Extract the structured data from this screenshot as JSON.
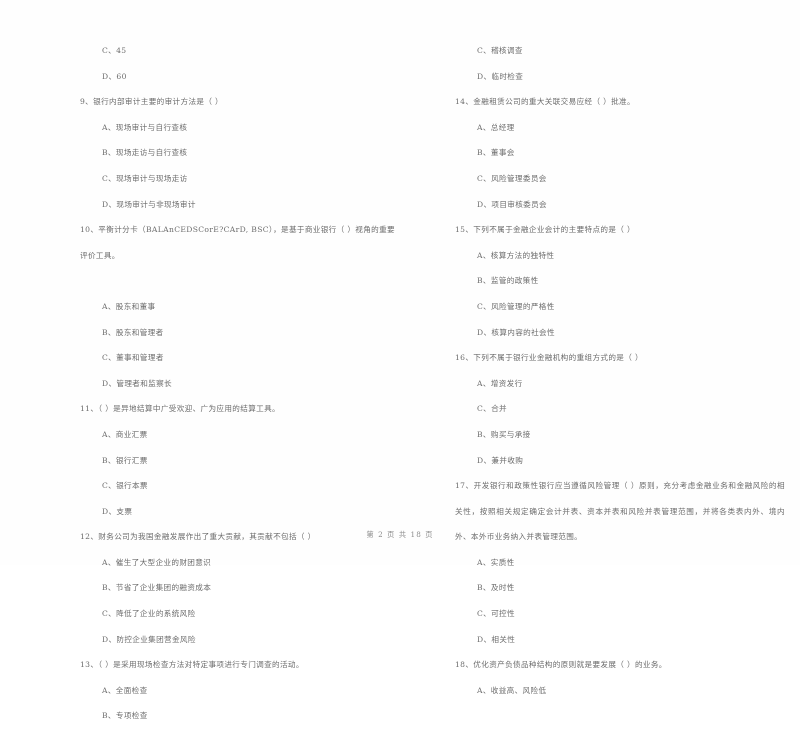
{
  "document": {
    "type": "scanned-exam-paper",
    "language": "zh-CN",
    "footer": "第 2 页 共 18 页"
  },
  "left_column": {
    "items": [
      {
        "kind": "option",
        "text": "C、45"
      },
      {
        "kind": "option",
        "text": "D、60"
      },
      {
        "kind": "question",
        "text": "9、银行内部审计主要的审计方法是（      ）"
      },
      {
        "kind": "option",
        "text": "A、现场审计与自行查核"
      },
      {
        "kind": "option",
        "text": "B、现场走访与自行查核"
      },
      {
        "kind": "option",
        "text": "C、现场审计与现场走访"
      },
      {
        "kind": "option",
        "text": "D、现场审计与非现场审计"
      },
      {
        "kind": "question-wrap",
        "text": "10、平衡计分卡（BALAnCEDSCorE?CArD, BSC），是基于商业银行（      ）视角的重要评价工具。"
      },
      {
        "kind": "blank",
        "text": ""
      },
      {
        "kind": "option",
        "text": "A、股东和董事"
      },
      {
        "kind": "option",
        "text": "B、股东和管理者"
      },
      {
        "kind": "option",
        "text": "C、董事和管理者"
      },
      {
        "kind": "option",
        "text": "D、管理者和监察长"
      },
      {
        "kind": "question",
        "text": "11、（      ）是异地结算中广受欢迎、广为应用的结算工具。"
      },
      {
        "kind": "option",
        "text": "A、商业汇票"
      },
      {
        "kind": "option",
        "text": "B、银行汇票"
      },
      {
        "kind": "option",
        "text": "C、银行本票"
      },
      {
        "kind": "option",
        "text": "D、支票"
      },
      {
        "kind": "question",
        "text": "12、财务公司为我国金融发展作出了重大贡献，其贡献不包括（      ）"
      },
      {
        "kind": "option",
        "text": "A、催生了大型企业的财团意识"
      },
      {
        "kind": "option",
        "text": "B、节省了企业集团的融资成本"
      },
      {
        "kind": "option",
        "text": "C、降低了企业的系统风险"
      },
      {
        "kind": "option",
        "text": "D、防控企业集团营金风险"
      },
      {
        "kind": "question",
        "text": "13、（      ）是采用现场检查方法对特定事项进行专门调查的活动。"
      },
      {
        "kind": "option",
        "text": "A、全面检查"
      },
      {
        "kind": "option",
        "text": "B、专项检查"
      }
    ]
  },
  "right_column": {
    "items": [
      {
        "kind": "option",
        "text": "C、稽核调查"
      },
      {
        "kind": "option",
        "text": "D、临时检查"
      },
      {
        "kind": "question",
        "text": "14、金融租赁公司的重大关联交易应经（      ）批准。"
      },
      {
        "kind": "option",
        "text": "A、总经理"
      },
      {
        "kind": "option",
        "text": "B、董事会"
      },
      {
        "kind": "option",
        "text": "C、风险管理委员会"
      },
      {
        "kind": "option",
        "text": "D、项目审核委员会"
      },
      {
        "kind": "question",
        "text": "15、下列不属于金融企业会计的主要特点的是（      ）"
      },
      {
        "kind": "option",
        "text": "A、核算方法的独特性"
      },
      {
        "kind": "option",
        "text": "B、监管的政策性"
      },
      {
        "kind": "option",
        "text": "C、风险管理的严格性"
      },
      {
        "kind": "option",
        "text": "D、核算内容的社会性"
      },
      {
        "kind": "question",
        "text": "16、下列不属于银行业金融机构的重组方式的是（      ）"
      },
      {
        "kind": "option",
        "text": "A、增资发行"
      },
      {
        "kind": "option",
        "text": "C、合并"
      },
      {
        "kind": "option",
        "text": "B、购买与承接"
      },
      {
        "kind": "option",
        "text": "D、兼并收购"
      },
      {
        "kind": "question-wrap17",
        "text": "17、开发银行和政策性银行应当遵循风险管理（      ）原则，充分考虑金融业务和金融风险的相关性，按照相关规定确定会计并表、资本并表和风险并表管理范围，并将各类表内外、境内外、本外币业务纳入并表管理范围。"
      },
      {
        "kind": "option",
        "text": "A、实质性"
      },
      {
        "kind": "option",
        "text": "B、及时性"
      },
      {
        "kind": "option",
        "text": "C、可控性"
      },
      {
        "kind": "option",
        "text": "D、相关性"
      },
      {
        "kind": "question",
        "text": "18、优化资产负债品种结构的原则就是要发展（      ）的业务。"
      },
      {
        "kind": "option",
        "text": "A、收益高、风险低"
      }
    ]
  }
}
